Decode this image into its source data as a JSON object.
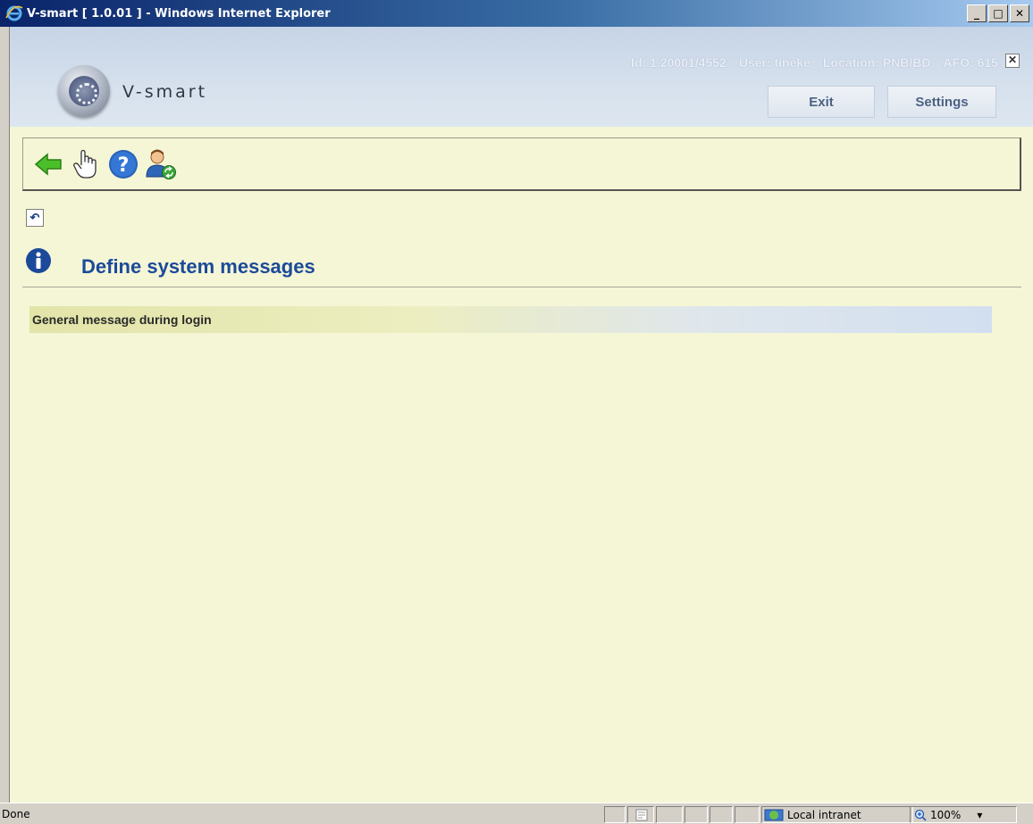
{
  "window": {
    "title": "V-smart [ 1.0.01 ] - Windows Internet Explorer",
    "minimize": "_",
    "maximize": "□",
    "close": "✕"
  },
  "header": {
    "brand": "V-smart",
    "session": {
      "id": "Id: 1.20001/4552",
      "user": "User: tineke",
      "location": "Location: PNB/BD",
      "afo": "AFO: 615"
    },
    "close_glyph": "✕",
    "exit_label": "Exit",
    "settings_label": "Settings"
  },
  "toolbar": {
    "icons": [
      "back-arrow-icon",
      "select-hand-icon",
      "help-icon",
      "switch-user-icon"
    ]
  },
  "page": {
    "undo_glyph": "↶",
    "title": "Define system messages",
    "items": [
      {
        "label": "General message during login"
      }
    ]
  },
  "statusbar": {
    "status": "Done",
    "zone": "Local intranet",
    "zoom": "100%",
    "zoom_caret": "▾"
  },
  "colors": {
    "background": "#f5f6d6",
    "title_blue": "#1c4a9a",
    "header_band": "#c6d4e6"
  }
}
